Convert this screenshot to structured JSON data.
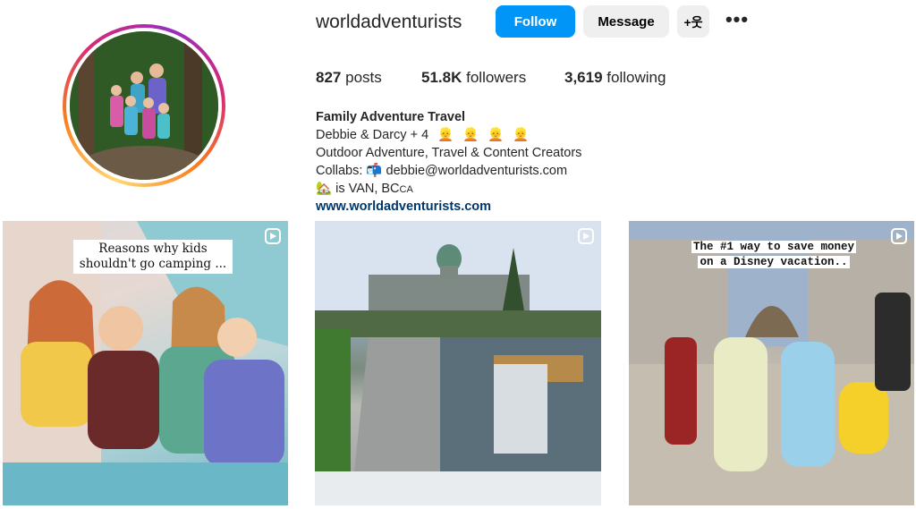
{
  "profile": {
    "username": "worldadventurists",
    "buttons": {
      "follow": "Follow",
      "message": "Message",
      "suggest": "+웃",
      "more": "•••"
    },
    "stats": [
      {
        "value": "827",
        "label": "posts"
      },
      {
        "value": "51.8K",
        "label": "followers"
      },
      {
        "value": "3,619",
        "label": "following"
      }
    ],
    "bio": {
      "name": "Family Adventure Travel",
      "line1": "Debbie & Darcy + 4",
      "line1_emojis": [
        "👱",
        "👱",
        "👱",
        "👱"
      ],
      "line2": "Outdoor Adventure, Travel & Content Creators",
      "line3_prefix": "Collabs:",
      "line3_icon": "📬",
      "line3_email": "debbie@worldadventurists.com",
      "line4_icon": "🏡",
      "line4_text": "is VAN, BC",
      "line4_flag": "CA",
      "website": "www.worldadventurists.com"
    }
  },
  "posts": [
    {
      "caption_line1": "Reasons why kids",
      "caption_line2": "shouldn't go camping ...",
      "icon": "reel-icon"
    },
    {
      "caption": "",
      "icon": "reel-icon"
    },
    {
      "caption_line1": "The #1 way to save money",
      "caption_line2": "on a Disney vacation..",
      "icon": "reel-icon"
    }
  ],
  "colors": {
    "accent": "#0095f6",
    "link": "#00376b",
    "secondary_btn": "#efefef"
  }
}
